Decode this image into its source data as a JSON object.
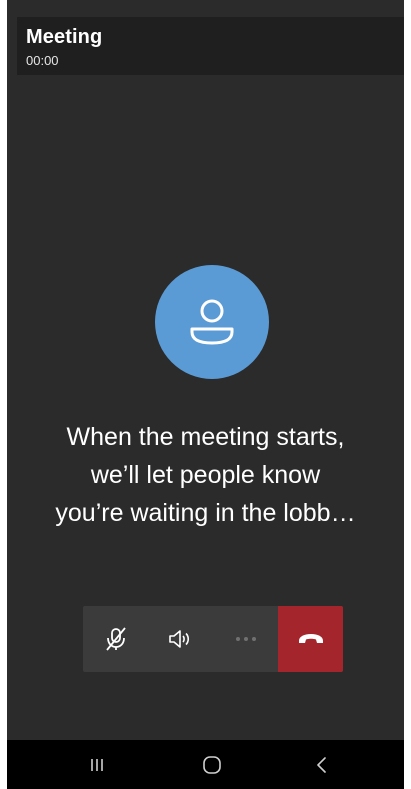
{
  "header": {
    "title": "Meeting",
    "timer": "00:00"
  },
  "status": {
    "lines": [
      "When the meeting starts,",
      "we’ll let people know",
      "you’re waiting in the lobb…"
    ]
  },
  "avatar": {
    "icon": "person-icon",
    "color": "#5b9bd5"
  },
  "controls": {
    "mic": {
      "icon": "mic-off-icon",
      "state": "muted"
    },
    "speaker": {
      "icon": "speaker-icon"
    },
    "more": {
      "icon": "more-options-icon",
      "enabled": false
    },
    "hangup": {
      "icon": "hang-up-icon",
      "color": "#a4262c"
    }
  },
  "navbar": {
    "recent": {
      "icon": "recent-apps-icon"
    },
    "home": {
      "icon": "home-icon"
    },
    "back": {
      "icon": "back-icon"
    }
  },
  "colors": {
    "background": "#2b2b2b",
    "header": "#1f1f1f",
    "controls": "#3b3b3b"
  }
}
